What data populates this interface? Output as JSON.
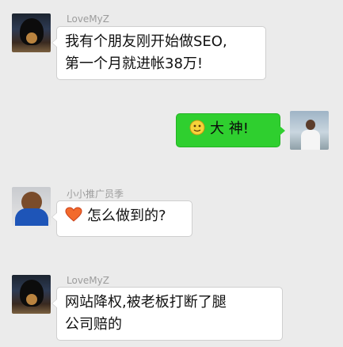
{
  "messages": [
    {
      "sender": "LoveMyZ",
      "side": "left",
      "lines": [
        "我有个朋友刚开始做SEO,",
        "第一个月就进帐38万!"
      ]
    },
    {
      "sender": "",
      "side": "right",
      "emoji": "smiley-emoji-icon",
      "text": "大 神!"
    },
    {
      "sender": "小小推广员季",
      "side": "left",
      "emoji": "heart-emoji-icon",
      "text": "怎么做到的?"
    },
    {
      "sender": "LoveMyZ",
      "side": "left",
      "lines": [
        "网站降权,被老板打断了腿",
        "公司赔的"
      ]
    }
  ],
  "colors": {
    "background": "#ebebeb",
    "sent_bubble": "#2fcf2f",
    "received_bubble": "#ffffff",
    "sender_name": "#9c9c9c"
  }
}
